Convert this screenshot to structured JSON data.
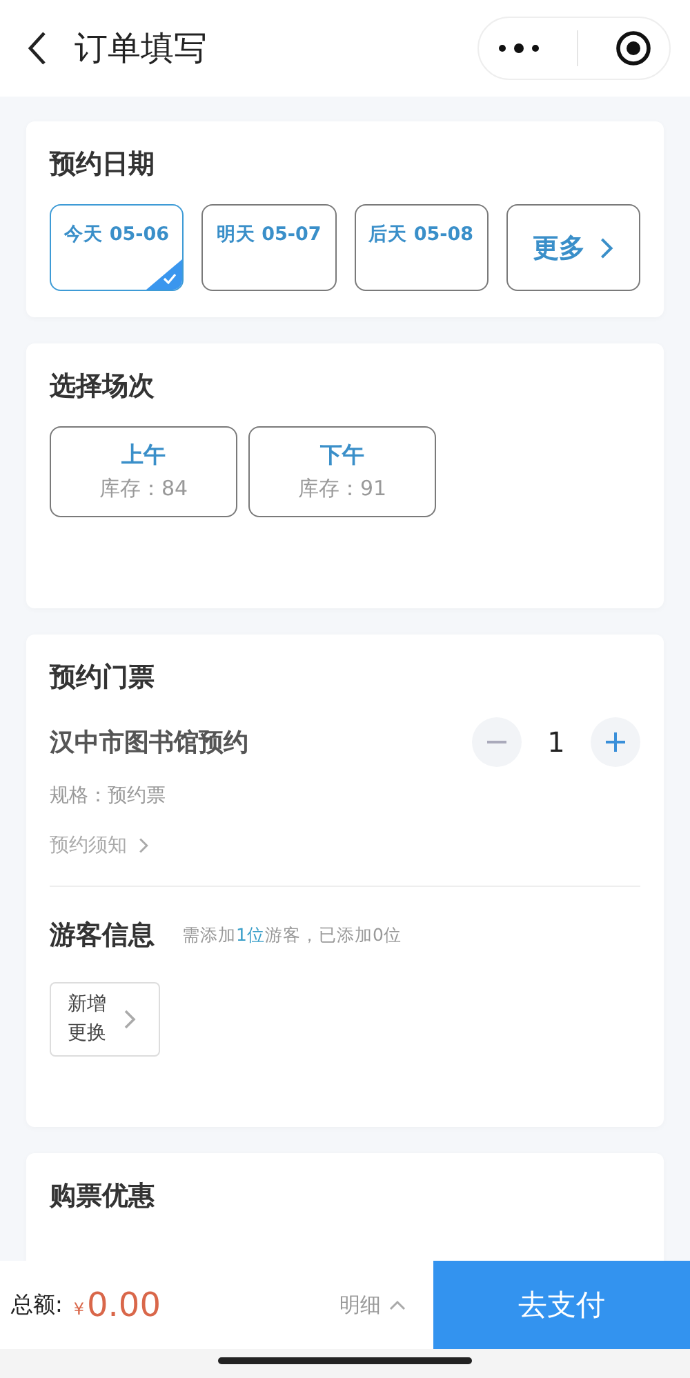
{
  "header": {
    "title": "订单填写"
  },
  "date_section": {
    "title": "预约日期",
    "dates": [
      {
        "label": "今天 05-06",
        "selected": true
      },
      {
        "label": "明天 05-07",
        "selected": false
      },
      {
        "label": "后天 05-08",
        "selected": false
      }
    ],
    "more": "更多"
  },
  "session_section": {
    "title": "选择场次",
    "sessions": [
      {
        "name": "上午",
        "stock": "库存：84"
      },
      {
        "name": "下午",
        "stock": "库存：91"
      }
    ]
  },
  "ticket_section": {
    "title": "预约门票",
    "ticket": {
      "name": "汉中市图书馆预约",
      "spec": "规格：预约票",
      "notice": "预约须知",
      "quantity": "1"
    },
    "visitor": {
      "title": "游客信息",
      "hint_parts": [
        "需添加",
        "1位",
        "游客，已添加0位"
      ],
      "add_lines": [
        "新增",
        "更换"
      ]
    }
  },
  "discount_section": {
    "title": "购票优惠"
  },
  "footer": {
    "total_label": "总额:",
    "currency": "¥",
    "amount": "0.00",
    "detail": "明细",
    "pay": "去支付"
  }
}
